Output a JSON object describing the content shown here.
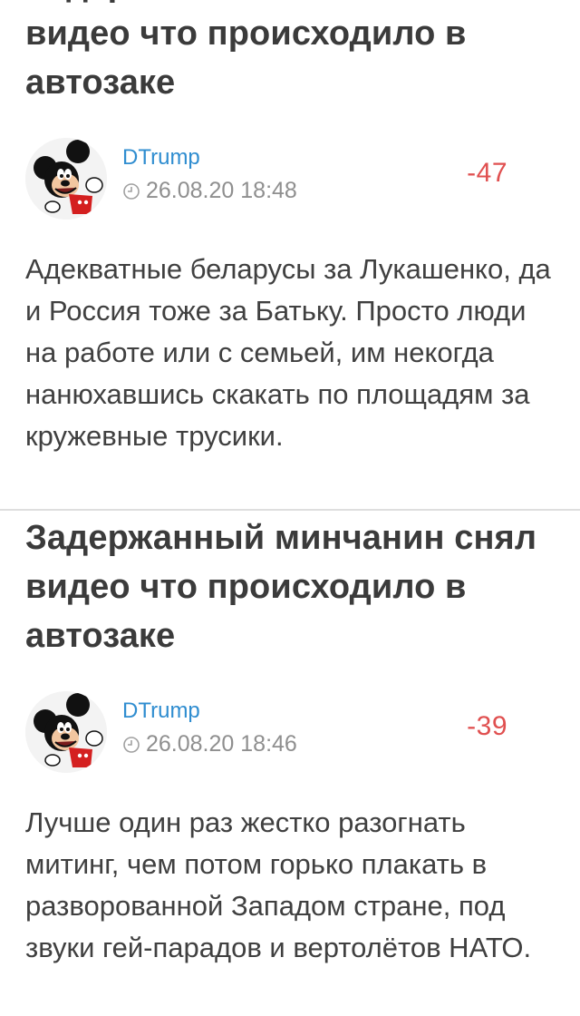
{
  "posts": [
    {
      "title": "Задержанный минчанин снял видео что происходило в автозаке",
      "author": "DTrump",
      "date": "26.08.20 18:48",
      "score": "-47",
      "text": "Адекватные беларусы за Лукашенко, да и Россия тоже за Батьку. Просто люди на работе или с семьей, им некогда нанюхавшись скакать по площадям за кружевные трусики.",
      "avatar_icon": "mickey-mouse-avatar"
    },
    {
      "title": "Задержанный минчанин снял видео что происходило в автозаке",
      "author": "DTrump",
      "date": "26.08.20 18:46",
      "score": "-39",
      "text": "Лучше один раз жестко разогнать митинг, чем потом горько плакать в разворованной Западом стране, под звуки гей-парадов и вертолётов НАТО.",
      "avatar_icon": "mickey-mouse-avatar"
    }
  ],
  "colors": {
    "title": "#3b3b3b",
    "author": "#2f8dd0",
    "date": "#8f8f8f",
    "score": "#e05050",
    "text": "#404040",
    "divider": "#dedede"
  }
}
